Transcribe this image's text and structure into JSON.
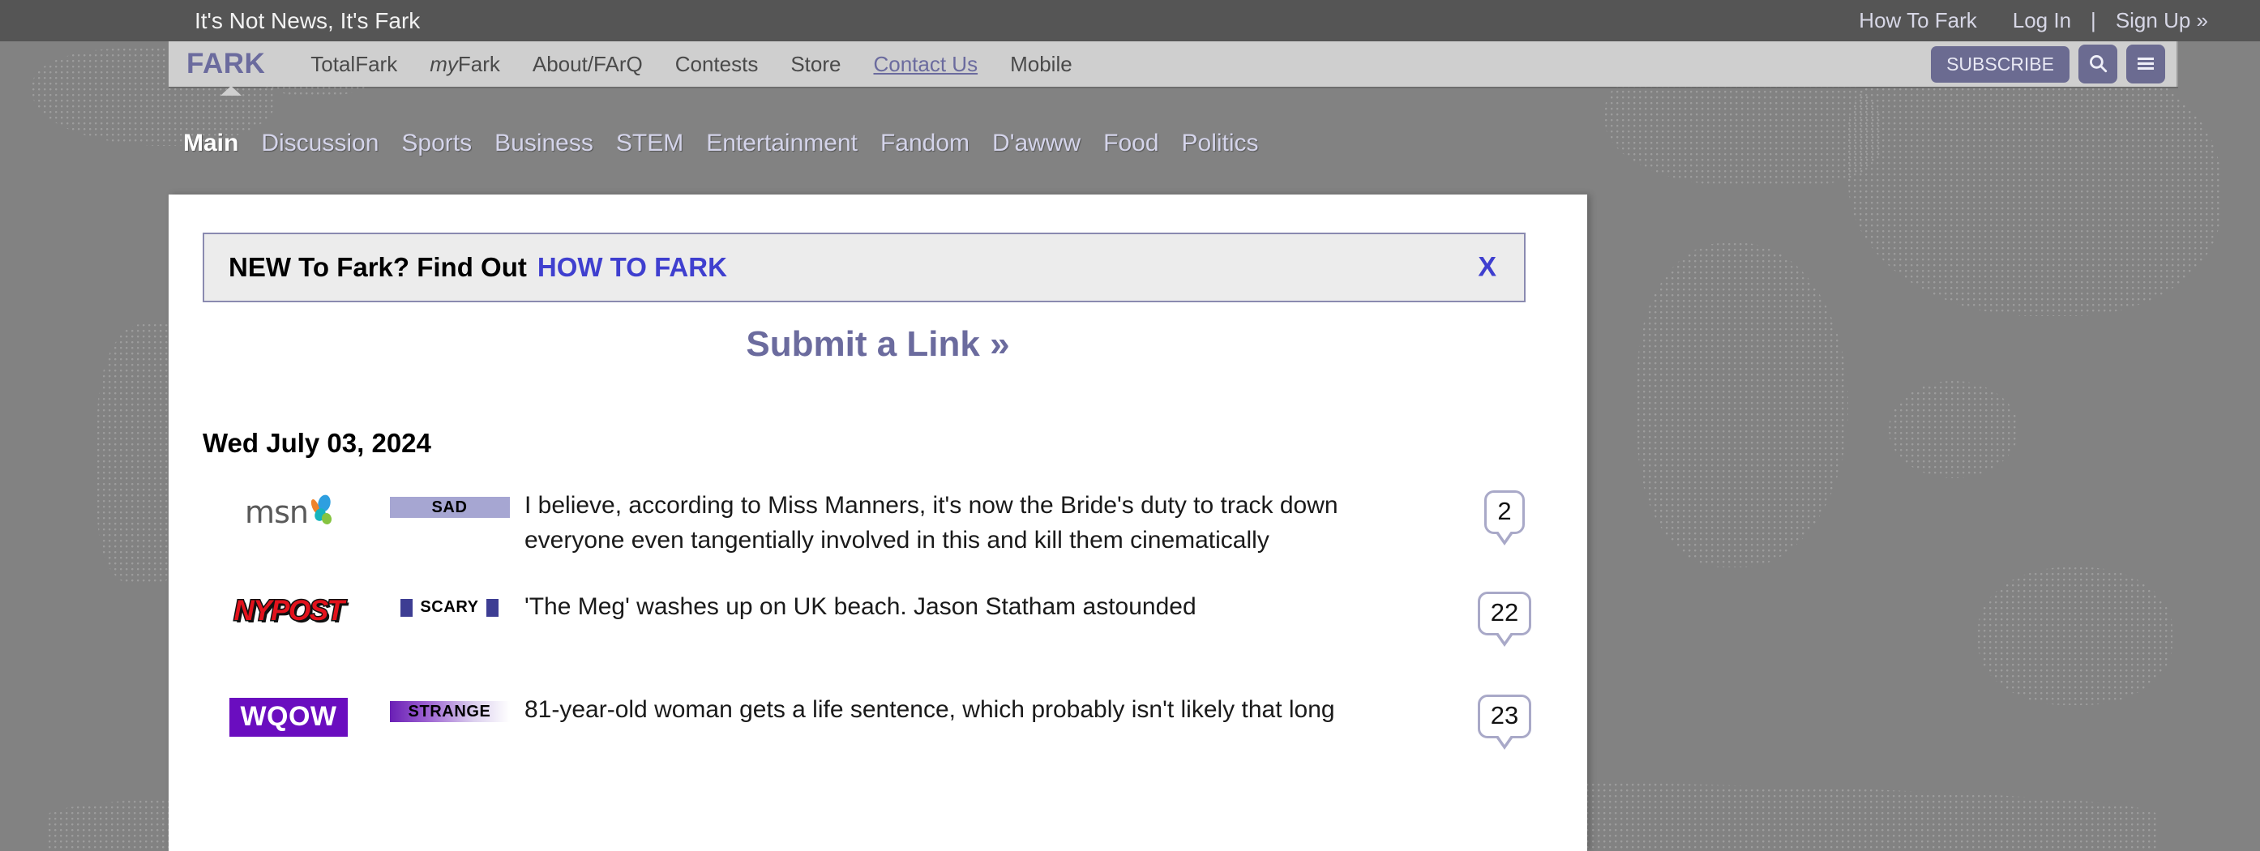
{
  "topbar": {
    "tagline": "It's Not News, It's Fark",
    "links": [
      {
        "label": "How To Fark"
      },
      {
        "label": "Log In"
      },
      {
        "label": "Sign Up »"
      }
    ],
    "divider": "|"
  },
  "navbar": {
    "logo": "FARK",
    "links": [
      {
        "label": "TotalFark",
        "active": false
      },
      {
        "label": "myFark",
        "active": false
      },
      {
        "label": "About/FArQ",
        "active": false
      },
      {
        "label": "Contests",
        "active": false
      },
      {
        "label": "Store",
        "active": false
      },
      {
        "label": "Contact Us",
        "active": true
      },
      {
        "label": "Mobile",
        "active": false
      }
    ],
    "subscribe_label": "SUBSCRIBE",
    "search_icon": "search-icon",
    "menu_icon": "hamburger-menu-icon",
    "accent_color": "#6b6b91"
  },
  "category_tabs": [
    {
      "label": "Main",
      "active": true
    },
    {
      "label": "Discussion",
      "active": false
    },
    {
      "label": "Sports",
      "active": false
    },
    {
      "label": "Business",
      "active": false
    },
    {
      "label": "STEM",
      "active": false
    },
    {
      "label": "Entertainment",
      "active": false
    },
    {
      "label": "Fandom",
      "active": false
    },
    {
      "label": "D'awww",
      "active": false
    },
    {
      "label": "Food",
      "active": false
    },
    {
      "label": "Politics",
      "active": false
    }
  ],
  "banner": {
    "text": "NEW To Fark? Find Out",
    "link_label": "HOW TO FARK",
    "close_label": "X",
    "link_color": "#3f3fcf"
  },
  "submit_link": {
    "label": "Submit a Link »"
  },
  "date_header": "Wed July 03, 2024",
  "stories": [
    {
      "publisher": "msn",
      "publisher_logo": "msn-logo",
      "tag": "SAD",
      "tag_style": "sad",
      "headline": "I believe, according to Miss Manners, it's now the Bride's duty to track down everyone even tangentially involved in this and kill them cinematically",
      "comments": "2"
    },
    {
      "publisher": "NYPOST",
      "publisher_logo": "nypost-logo",
      "tag": "SCARY",
      "tag_style": "scary",
      "headline": "'The Meg' washes up on UK beach. Jason Statham astounded",
      "comments": "22"
    },
    {
      "publisher": "WQOW",
      "publisher_logo": "wqow-logo",
      "tag": "STRANGE",
      "tag_style": "strange",
      "headline": "81-year-old woman gets a life sentence, which probably isn't likely that long",
      "comments": "23"
    }
  ]
}
